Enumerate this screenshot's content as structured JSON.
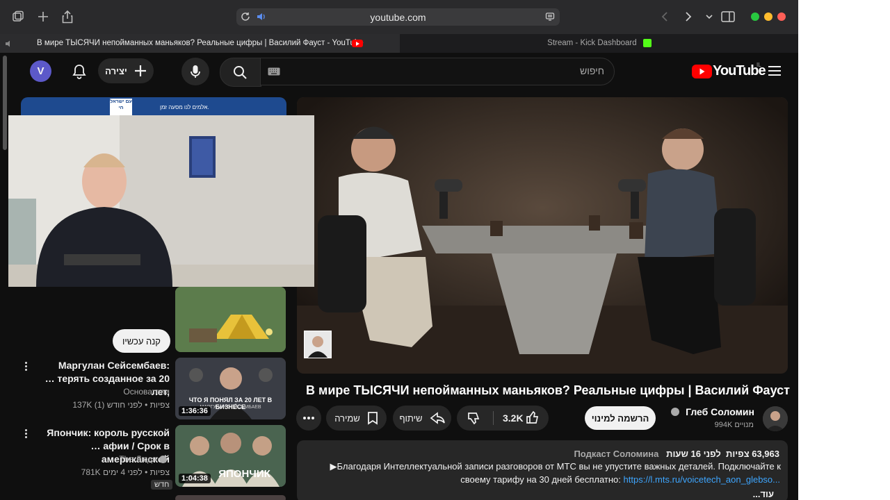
{
  "browser": {
    "url": "youtube.com",
    "tabs": [
      {
        "label": "В мире ТЫСЯЧИ непойманных маньяков? Реальные цифры | Василий Фауст - YouTube"
      },
      {
        "label": "Stream - Kick Dashboard"
      }
    ],
    "colors": {
      "close": "#ff5f57",
      "minimize": "#febc2e",
      "zoom": "#28c840"
    }
  },
  "header": {
    "avatar_letter": "V",
    "create_label": "יצירה",
    "search_placeholder": "חיפוש",
    "logo_text": "YouTube",
    "logo_country": "IL"
  },
  "video": {
    "title": "В мире ТЫСЯЧИ непойманных маньяков? Реальные цифры | Василий Фауст",
    "channel": "Глеб Соломин",
    "subscribers": "994K מנויים",
    "subscribe_label": "הרשמה למינוי",
    "likes": "3.2K",
    "share_label": "שיתוף",
    "save_label": "שמירה",
    "views": "63,963 צפיות",
    "time_ago": "לפני 16 שעות",
    "playlist": "Подкаст Соломина",
    "description_line1": "▶Благодаря Интеллектуальной записи разговоров от МТС вы не упустите важных деталей. Подключайте к",
    "description_line2_text": "своему тарифу на 30 дней бесплатно:",
    "description_link": "https://l.mts.ru/voicetech_aon_glebso...",
    "more_label": "...עוד"
  },
  "sidebar": {
    "ad": {
      "buy_label": "קנה עכשיו",
      "banner_text": "אלמים לנו מסעה זמן.",
      "banner_logo": "עם ישראל חי"
    },
    "items": [
      {
        "title1": "Маргулан Сейсембаев:",
        "title2": "… терять созданное за 20 лет,",
        "channel": "Основатели",
        "meta": "137K צפיות • לפני חודש (1)",
        "duration": "1:36:36",
        "thumb_text": "ЧТО Я ПОНЯЛ ЗА 20 ЛЕТ В БИЗНЕСЕ",
        "thumb_sub": "МАРГУЛАН СЕЙСЕМБАЕВ"
      },
      {
        "title1": "Япончик: король русской",
        "title2": "… афии / Срок в американской",
        "channel": "The Люди",
        "meta": "781K צפיות • לפני 4 ימים",
        "badge": "חדש",
        "duration": "1:04:38",
        "thumb_text": "ЯПОНЧИК"
      }
    ]
  }
}
